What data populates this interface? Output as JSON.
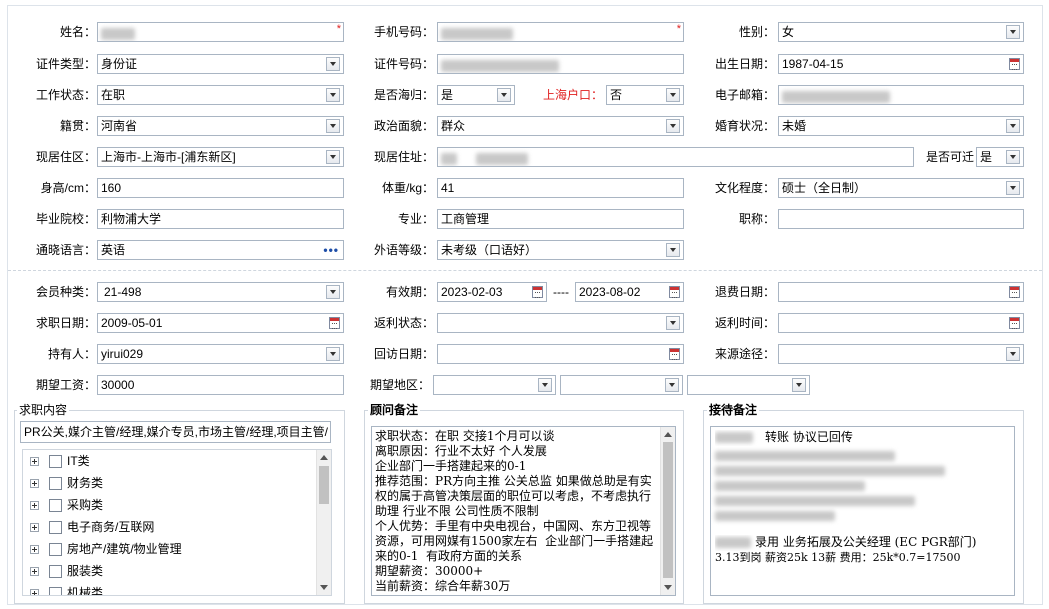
{
  "personal": {
    "name_label": "姓名：",
    "phone_label": "手机号码：",
    "gender_label": "性别：",
    "gender_value": "女",
    "id_type_label": "证件类型：",
    "id_type_value": "身份证",
    "id_number_label": "证件号码：",
    "birth_label": "出生日期：",
    "birth_value": "1987-04-15",
    "work_status_label": "工作状态：",
    "work_status_value": "在职",
    "overseas_label": "是否海归：",
    "overseas_value": "是",
    "shanghai_hukou_label": "上海户口：",
    "shanghai_hukou_value": "否",
    "email_label": "电子邮箱：",
    "native_label": "籍贯：",
    "native_value": "河南省",
    "political_label": "政治面貌：",
    "political_value": "群众",
    "marital_label": "婚育状况：",
    "marital_value": "未婚",
    "residence_area_label": "现居住区：",
    "residence_area_value": "上海市-上海市-[浦东新区]",
    "address_label": "现居住址：",
    "relocate_label": "是否可迁",
    "relocate_value": "是",
    "height_label": "身高/cm：",
    "height_value": "160",
    "weight_label": "体重/kg：",
    "weight_value": "41",
    "education_label": "文化程度：",
    "education_value": "硕士（全日制）",
    "school_label": "毕业院校：",
    "school_value": "利物浦大学",
    "major_label": "专业：",
    "major_value": "工商管理",
    "title_label": "职称：",
    "language_label": "通晓语言：",
    "language_value": "英语",
    "foreign_level_label": "外语等级：",
    "foreign_level_value": "未考级（口语好）",
    "required_mark": "*"
  },
  "membership": {
    "member_type_label": "会员种类：",
    "member_type_value": "21-498",
    "valid_label": "有效期：",
    "valid_from": "2023-02-03",
    "valid_dash": "----",
    "valid_to": "2023-08-02",
    "refund_date_label": "退费日期：",
    "job_date_label": "求职日期：",
    "job_date_value": "2009-05-01",
    "rebate_status_label": "返利状态：",
    "rebate_time_label": "返利时间：",
    "holder_label": "持有人：",
    "holder_value": "yirui029",
    "revisit_label": "回访日期：",
    "source_label": "来源途径：",
    "salary_label": "期望工资：",
    "salary_value": "30000",
    "region_label": "期望地区："
  },
  "job_content": {
    "title": "求职内容",
    "summary": "PR公关,媒介主管/经理,媒介专员,市场主管/经理,项目主管/",
    "categories": [
      "IT类",
      "财务类",
      "采购类",
      "电子商务/互联网",
      "房地产/建筑/物业管理",
      "服装类",
      "机械类"
    ]
  },
  "consultant_notes": {
    "title": "顾问备注",
    "text": "求职状态：在职 交接1个月可以谈\n离职原因：行业不太好 个人发展\n企业部门一手搭建起来的0-1\n推荐范围：PR方向主推 公关总监 如果做总助是有实权的属于高管决策层面的职位可以考虑，不考虑执行助理 行业不限 公司性质不限制\n个人优势：手里有中央电视台，中国网、东方卫视等资源，可用网媒有1500家左右  企业部门一手搭建起来的0-1  有政府方面的关系\n期望薪资：30000+\n当前薪资：综合年薪30万"
  },
  "reception_notes": {
    "title": "接待备注",
    "line1": "转账 协议已回传",
    "line2": "录用 业务拓展及公关经理 (EC PGR部门)",
    "line3": "3.13到岗 薪资25k 13薪 费用：25k*0.7=17500"
  },
  "icons": {
    "dropdown": "chevron-down-icon",
    "calendar": "calendar-icon",
    "more": "ellipsis-icon",
    "expand": "plus-expand-icon",
    "checkbox": "checkbox-icon"
  },
  "colors": {
    "border": "#a9b5c3",
    "required": "#e02020",
    "link": "#1e4ea8"
  }
}
